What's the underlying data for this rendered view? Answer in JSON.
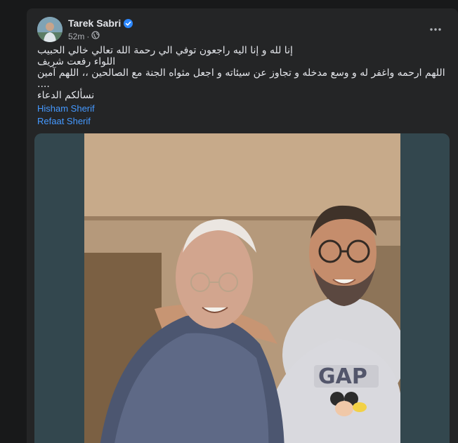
{
  "post": {
    "author": "Tarek Sabri",
    "time": "52m",
    "audience_icon": "globe-icon",
    "verified_icon": "verified-badge-icon",
    "more_icon": "more-options-icon",
    "text_lines": [
      "إنا لله و إنا اليه راجعون توفي الي رحمة الله تعالي خالي الحبيب",
      "اللواء رفعت شريف",
      "اللهم ارحمه واغفر له و وسع مدخله و تجاوز عن سيئاته و اجعل مثواه الجنة مع الصالحين ،، اللهم آمين ....",
      "نسألكم الدعاء"
    ],
    "tags": [
      "Hisham Sherif",
      "Refaat Sherif"
    ],
    "photo_icon": "post-photo",
    "colors": {
      "card": "#242526",
      "text": "#e4e6eb",
      "secondary_text": "#b0b3b8",
      "link": "#4599ff",
      "verified": "#2d88ff",
      "photo_border": "#33474e"
    }
  }
}
